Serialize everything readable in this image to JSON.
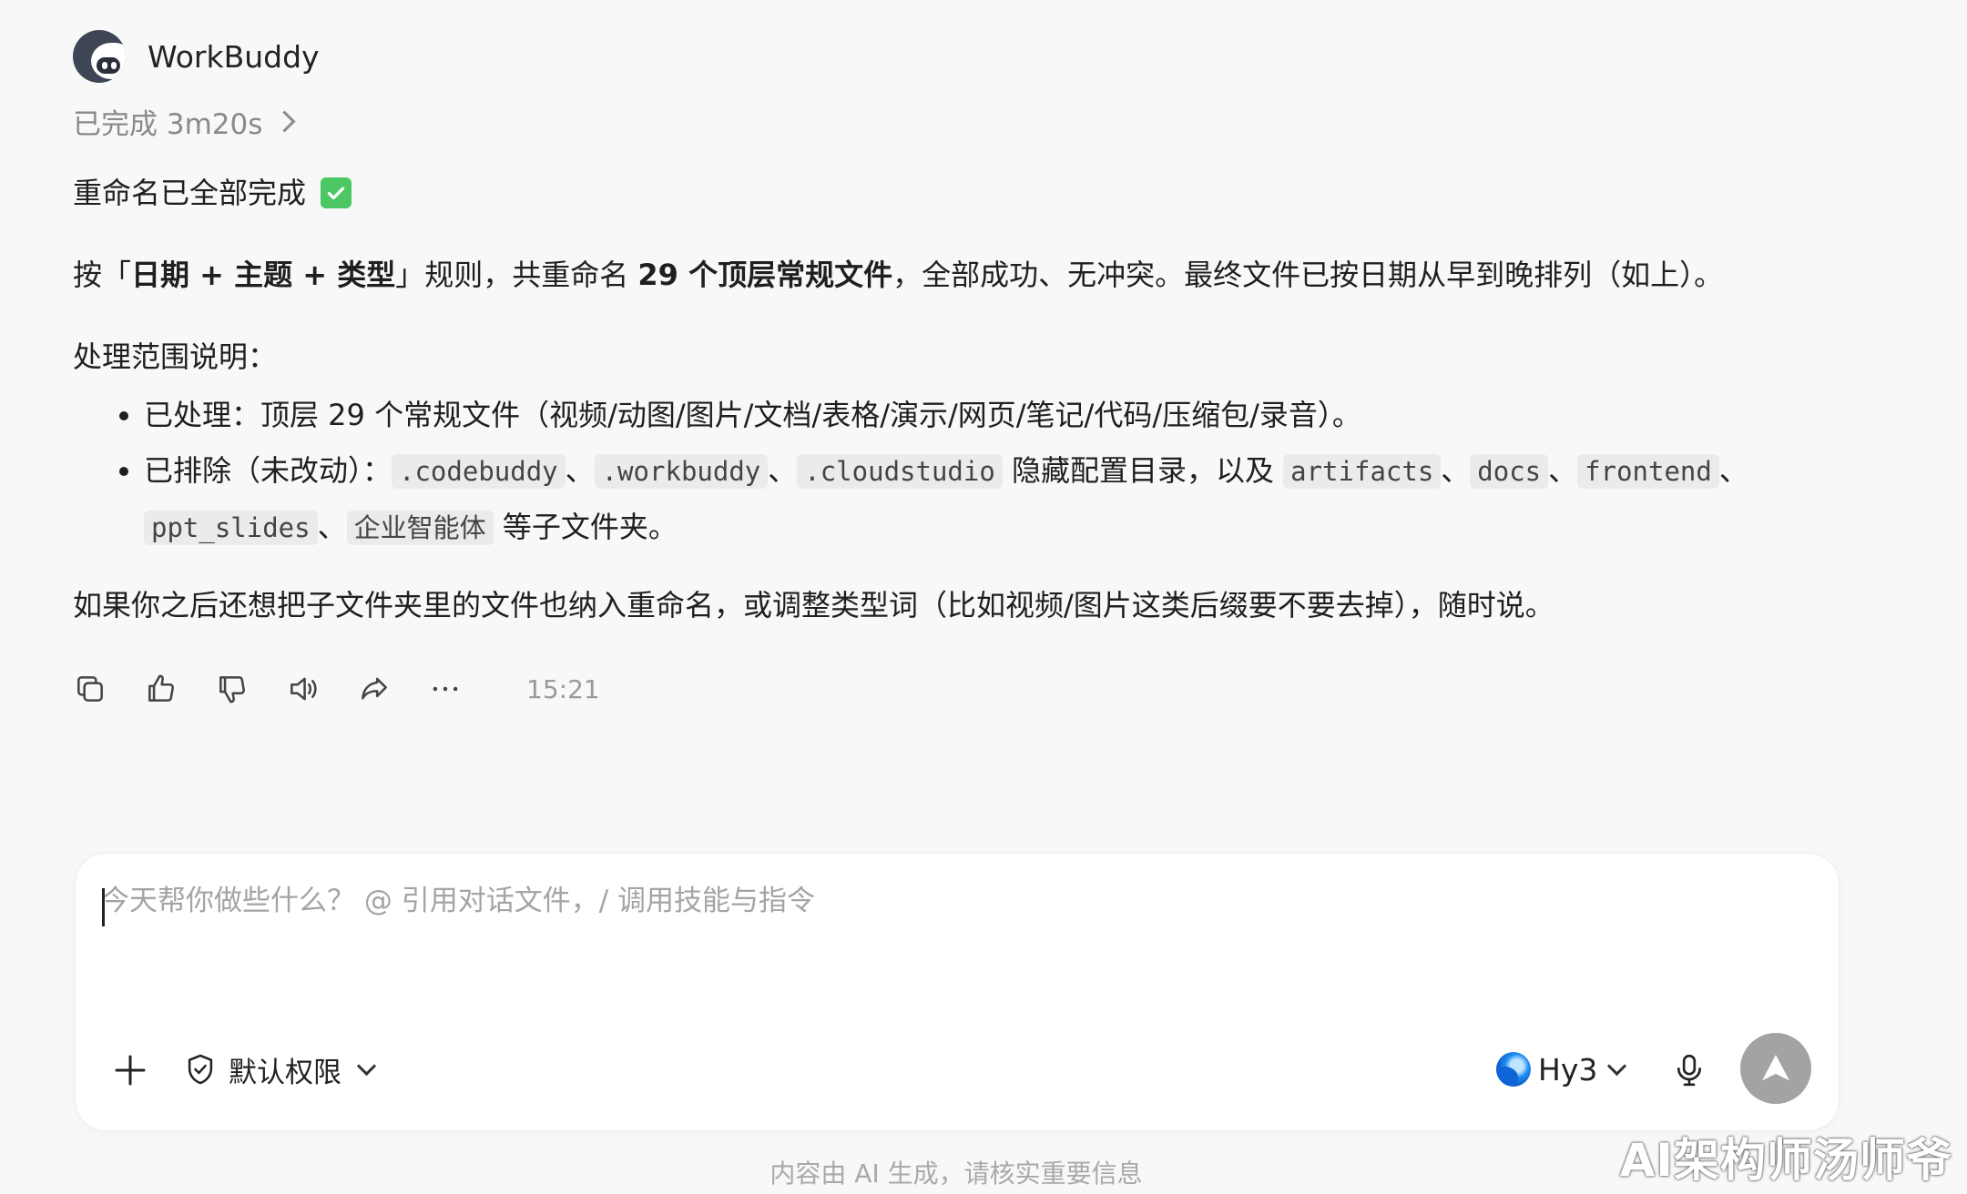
{
  "agent": {
    "name": "WorkBuddy",
    "avatar_icon": "workbuddy-avatar"
  },
  "status": {
    "text": "已完成 3m20s"
  },
  "message": {
    "title": "重命名已全部完成",
    "title_icon": "check-mark-emoji",
    "rule": {
      "p1": "按「",
      "b1": "日期 + 主题 + 类型",
      "p2": "」规则，共重命名 ",
      "b2": "29 个顶层常规文件",
      "p3": "，全部成功、无冲突。最终文件已按日期从早到晚排列（如上）。"
    },
    "scope_title": "处理范围说明：",
    "processed": "已处理：顶层 29 个常规文件（视频/动图/图片/文档/表格/演示/网页/笔记/代码/压缩包/录音）。",
    "excluded": {
      "label": "已排除（未改动）：",
      "hidden_dirs": [
        ".codebuddy",
        ".workbuddy",
        ".cloudstudio"
      ],
      "mid_text": "隐藏配置目录，以及",
      "sub_dirs": [
        "artifacts",
        "docs",
        "frontend",
        "ppt_slides",
        "企业智能体"
      ],
      "tail": "等子文件夹。",
      "sep": "、"
    },
    "follow_up": "如果你之后还想把子文件夹里的文件也纳入重命名，或调整类型词（比如视频/图片这类后缀要不要去掉），随时说。"
  },
  "actions": {
    "icons": [
      "copy-icon",
      "thumbs-up-icon",
      "thumbs-down-icon",
      "speaker-icon",
      "share-icon",
      "more-icon"
    ],
    "time": "15:21"
  },
  "composer": {
    "placeholder": "今天帮你做些什么？ @ 引用对话文件，/ 调用技能与指令",
    "permission_label": "默认权限",
    "model_label": "Hy3"
  },
  "footer": {
    "disclaimer": "内容由 AI 生成，请核实重要信息"
  },
  "watermark": "AI架构师汤师爷",
  "colors": {
    "check": "#4cc764",
    "send_button": "#a3a3a3",
    "code_bg": "#ebebeb"
  }
}
